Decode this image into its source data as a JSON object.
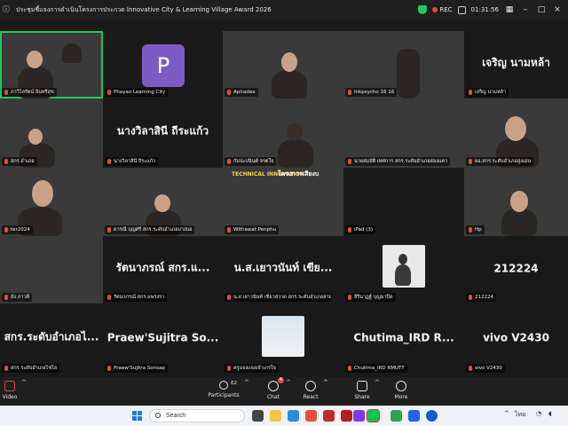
{
  "window": {
    "title": "ประชุมชี้แจงการดำเนินโครงการประกวด Innovative City & Learning Village Award 2026",
    "rec_label": "REC",
    "timer": "01:31:56"
  },
  "tiles": [
    {
      "id": "t1",
      "name": "ภาวิไลรัตน์ อินทรีสุข",
      "big": "",
      "video": true
    },
    {
      "id": "t2",
      "name": "Phayao Learning City",
      "big": "",
      "avatar": "P",
      "video": false
    },
    {
      "id": "t3",
      "name": "Apiradee",
      "big": "",
      "video": true
    },
    {
      "id": "t4",
      "name": "Inkpsycho 16 16",
      "big": "",
      "video": true
    },
    {
      "id": "t5",
      "name": "เจริญ นามหล้า",
      "big": "เจริญ นามหล้า",
      "video": false
    },
    {
      "id": "t6",
      "name": "สกร.อำเภอ",
      "big": "",
      "video": true
    },
    {
      "id": "t7",
      "name": "นางวิลาสินี ถีระแก้ว",
      "big": "นางวิลาสินี ถีระแก้ว",
      "video": false
    },
    {
      "id": "t8",
      "name": "กัมปะปนินต์ จรตใจ",
      "big": "",
      "video": true
    },
    {
      "id": "t9",
      "name": "นายสมบัติ เทศการ สกร.ระดับอำเภอสองแคว",
      "big": "",
      "video": true
    },
    {
      "id": "t10",
      "name": "ผอ.สกร.ระดับอำเภอสูงเม่น",
      "big": "",
      "video": true
    },
    {
      "id": "t11",
      "name": "ter2024",
      "big": "",
      "video": true
    },
    {
      "id": "t12",
      "name": "ดารณี บุญศรี สกร.ระดับอำเภอบางบอ",
      "big": "",
      "video": true
    },
    {
      "id": "t13",
      "name": "Withawat Penphu",
      "big": "",
      "video": true,
      "banner": "TECHNICAL INNOVATION",
      "banner2": "โครงการเสียงบ"
    },
    {
      "id": "t14",
      "name": "iPad (3)",
      "big": "",
      "video": false
    },
    {
      "id": "t15",
      "name": "Hp",
      "big": "",
      "video": true
    },
    {
      "id": "t16",
      "name": "อัง ภาวดี",
      "big": "",
      "video": true
    },
    {
      "id": "t17",
      "name": "รัตนาภรณ์ สกร.แพรงรา",
      "big": "รัตนาภรณ์ สกร.แ...",
      "video": false
    },
    {
      "id": "t18",
      "name": "น.ส.เยาวนันท์ เขียวสวาด สกร.ระดับอำเภอสามโก้",
      "big": "น.ส.เยาวนันท์ เขีย...",
      "video": false
    },
    {
      "id": "t19",
      "name": "สิรินาฏฐ์ บุญมาปิด",
      "big": "",
      "video": false,
      "thumb": true
    },
    {
      "id": "t20",
      "name": "212224",
      "big": "212224",
      "video": false
    },
    {
      "id": "t21",
      "name": "สกร.ระดับอำเภอไชโย",
      "big": "สกร.ระดับอำเภอไ...",
      "video": false
    },
    {
      "id": "t22",
      "name": "Praew'Sujitra Sonsap",
      "big": "Praew'Sujitra So...",
      "video": false
    },
    {
      "id": "t23",
      "name": "ครูแจงแจงเจ้าเกรใจ",
      "big": "",
      "video": false,
      "thumb": true
    },
    {
      "id": "t24",
      "name": "Chutima_IRD RMUTT",
      "big": "Chutima_IRD R...",
      "video": false
    },
    {
      "id": "t25",
      "name": "vivo V2430",
      "big": "vivo V2430",
      "video": false
    }
  ],
  "toolbar": {
    "video_label": "Video",
    "participants_label": "Participants",
    "participants_count": "62",
    "chat_label": "Chat",
    "chat_badge": "4",
    "react_label": "React",
    "share_label": "Share",
    "more_label": "More"
  },
  "taskbar": {
    "search_placeholder": "Search",
    "lang": "ไทย"
  },
  "colors": {
    "active_border": "#22c55e",
    "rec": "#ef4444",
    "avatar": "#7c5cc4"
  }
}
